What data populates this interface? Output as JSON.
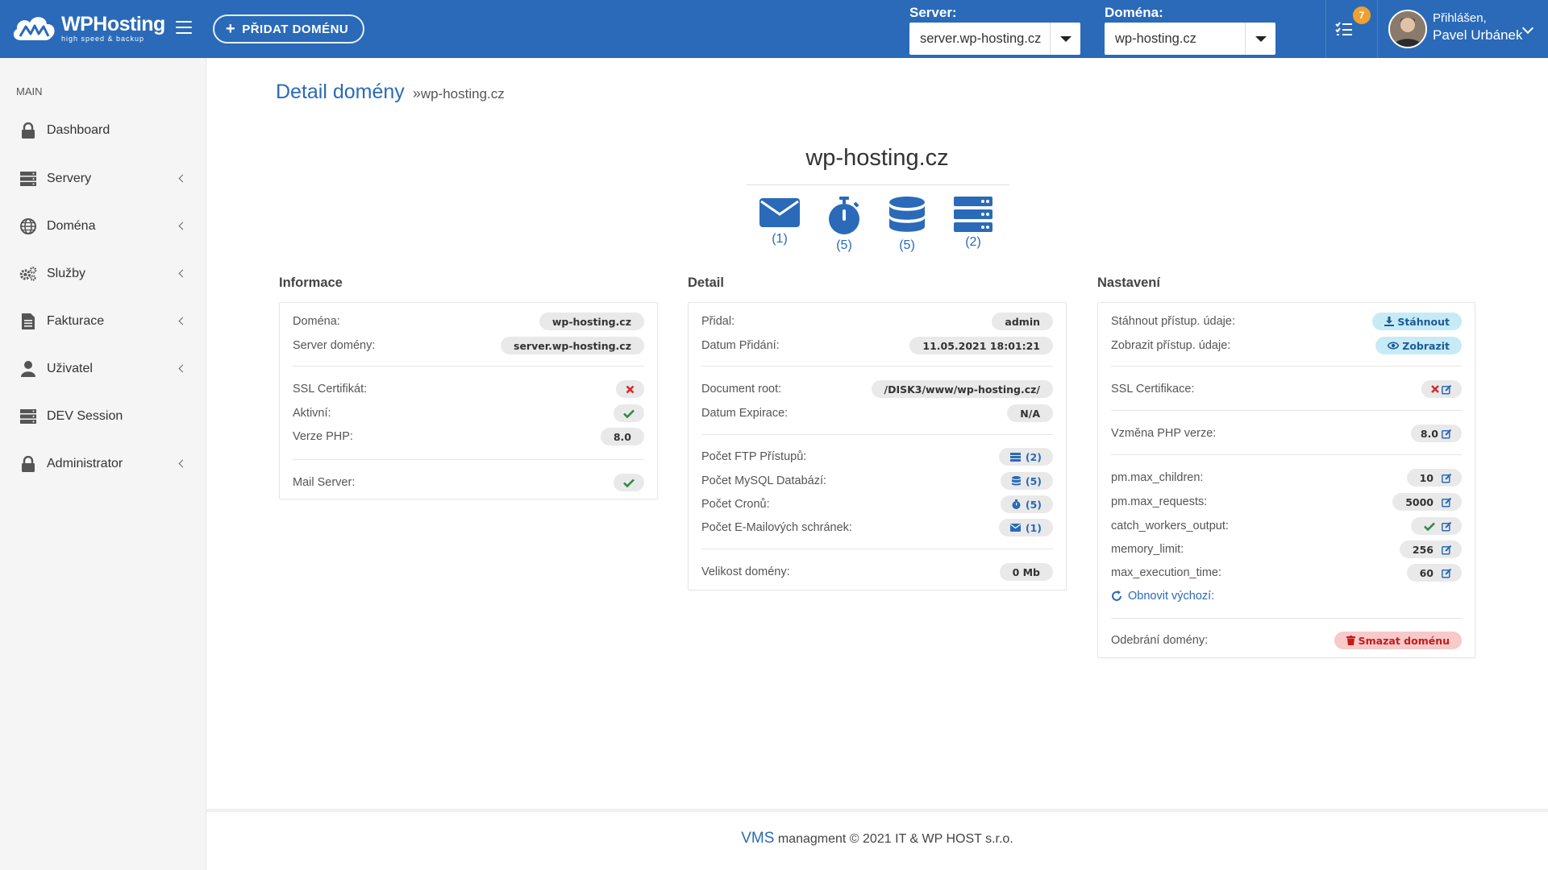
{
  "colors": {
    "primary": "#2a6ab8",
    "badge": "#f0a030",
    "danger": "#c41b1b",
    "info": "#c6ebf6"
  },
  "header": {
    "logo_title": "WPHosting",
    "logo_sub": "high speed & backup",
    "add_domain": "PŘIDAT DOMÉNU",
    "server_label": "Server:",
    "server_value": "server.wp-hosting.cz",
    "domain_label": "Doména:",
    "domain_value": "wp-hosting.cz",
    "tasks_badge": "7",
    "user_greeting": "Přihlášen,",
    "user_name": "Pavel Urbánek"
  },
  "sidebar": {
    "heading": "MAIN",
    "items": [
      {
        "label": "Dashboard",
        "icon": "lock-icon"
      },
      {
        "label": "Servery",
        "icon": "server-icon"
      },
      {
        "label": "Doména",
        "icon": "globe-icon"
      },
      {
        "label": "Služby",
        "icon": "cogs-icon"
      },
      {
        "label": "Fakturace",
        "icon": "invoice-icon"
      },
      {
        "label": "Uživatel",
        "icon": "user-icon"
      },
      {
        "label": "DEV Session",
        "icon": "server-icon"
      },
      {
        "label": "Administrator",
        "icon": "lock-icon"
      }
    ]
  },
  "page": {
    "title": "Detail domény",
    "sep": "»",
    "crumb": "wp-hosting.cz",
    "domain": "wp-hosting.cz",
    "services": [
      {
        "icon": "envelope-icon",
        "count": "(1)"
      },
      {
        "icon": "stopwatch-icon",
        "count": "(5)"
      },
      {
        "icon": "database-icon",
        "count": "(5)"
      },
      {
        "icon": "server-icon",
        "count": "(2)"
      }
    ]
  },
  "info": {
    "title": "Informace",
    "domain_k": "Doména:",
    "domain_v": "wp-hosting.cz",
    "server_k": "Server domény:",
    "server_v": "server.wp-hosting.cz",
    "ssl_k": "SSL Certifikát:",
    "active_k": "Aktivní:",
    "php_k": "Verze PHP:",
    "php_v": "8.0",
    "mail_k": "Mail Server:"
  },
  "detail": {
    "title": "Detail",
    "added_by_k": "Přidal:",
    "added_by_v": "admin",
    "added_k": "Datum Přidání:",
    "added_v": "11.05.2021 18:01:21",
    "root_k": "Document root:",
    "root_v": "/DISK3/www/wp-hosting.cz/",
    "exp_k": "Datum Expirace:",
    "exp_v": "N/A",
    "ftp_k": "Počet FTP Přístupů:",
    "ftp_v": "(2)",
    "mysql_k": "Počet MySQL Databází:",
    "mysql_v": "(5)",
    "cron_k": "Počet Cronů:",
    "cron_v": "(5)",
    "mail_k": "Počet E-Mailových schránek:",
    "mail_v": "(1)",
    "size_k": "Velikost domény:",
    "size_v": "0 Mb"
  },
  "settings": {
    "title": "Nastavení",
    "download_k": "Stáhnout přístup. údaje:",
    "download_btn": "Stáhnout",
    "show_k": "Zobrazit přístup. údaje:",
    "show_btn": "Zobrazit",
    "ssl_k": "SSL Certifikace:",
    "php_k": "Vzměna PHP verze:",
    "php_v": "8.0",
    "children_k": "pm.max_children:",
    "children_v": "10",
    "requests_k": "pm.max_requests:",
    "requests_v": "5000",
    "catch_k": "catch_workers_output:",
    "memory_k": "memory_limit:",
    "memory_v": "256",
    "exec_k": "max_execution_time:",
    "exec_v": "60",
    "restore": "Obnovit výchozí:",
    "remove_k": "Odebrání domény:",
    "remove_btn": "Smazat doménu"
  },
  "footer": {
    "brand": "VMS",
    "text": " managment © 2021 IT & WP HOST s.r.o."
  }
}
